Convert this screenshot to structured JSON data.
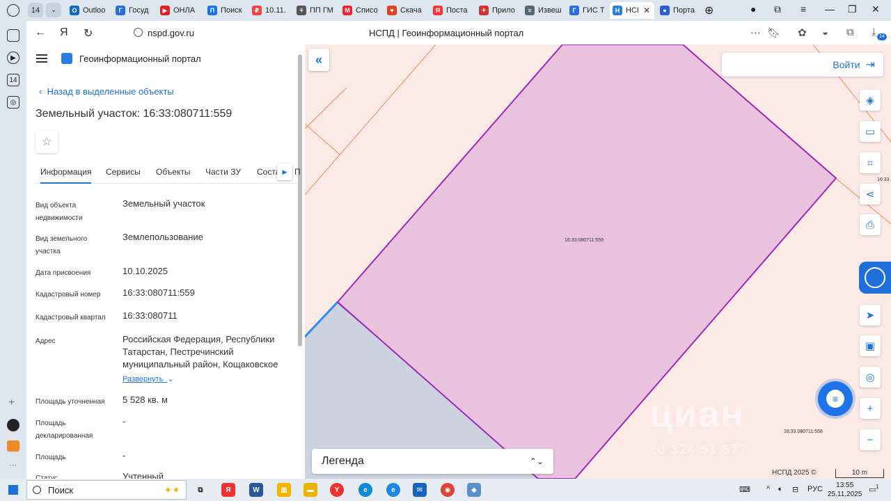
{
  "browser": {
    "tab_count": "14",
    "tabs": [
      {
        "label": "Outloo",
        "color": "#0f6cbd",
        "glyph": "O"
      },
      {
        "label": "Госуд",
        "color": "#2a6fd6",
        "glyph": "Г"
      },
      {
        "label": "ОНЛА",
        "color": "#d22",
        "glyph": "▶"
      },
      {
        "label": "Поиск",
        "color": "#1a73e8",
        "glyph": "П"
      },
      {
        "label": "10.11.",
        "color": "#e44",
        "glyph": "₽"
      },
      {
        "label": "ПП ГМ",
        "color": "#555",
        "glyph": "⚘"
      },
      {
        "label": "Списо",
        "color": "#e23",
        "glyph": "M"
      },
      {
        "label": "Скача",
        "color": "#d42",
        "glyph": "♥"
      },
      {
        "label": "Поста",
        "color": "#f33",
        "glyph": "Я"
      },
      {
        "label": "Прило",
        "color": "#c33",
        "glyph": "✈"
      },
      {
        "label": "Извеш",
        "color": "#567",
        "glyph": "≡"
      },
      {
        "label": "ГИС Т",
        "color": "#2a6fd6",
        "glyph": "Г"
      },
      {
        "label": "НСІ",
        "color": "#2a7de1",
        "glyph": "Н",
        "active": true
      },
      {
        "label": "Порта",
        "color": "#2a5cd6",
        "glyph": "●"
      }
    ],
    "url": "nspd.gov.ru",
    "page_title": "НСПД | Геоинформационный портал",
    "extension_badge": "14"
  },
  "panel": {
    "portal_name": "Геоинформационный портал",
    "back_link": "Назад в выделенные объекты",
    "title": "Земельный участок: 16:33:080711:559",
    "tabs": [
      "Информация",
      "Сервисы",
      "Объекты",
      "Части ЗУ",
      "Соста",
      "П"
    ],
    "expand_link": "Развернуть",
    "rows": [
      {
        "label": "Вид объекта недвижимости",
        "value": "Земельный участок"
      },
      {
        "label": "Вид земельного участка",
        "value": "Землепользование"
      },
      {
        "label": "Дата присвоения",
        "value": "10.10.2025"
      },
      {
        "label": "Кадастровый номер",
        "value": "16:33:080711:559"
      },
      {
        "label": "Кадастровый квартал",
        "value": "16:33:080711"
      },
      {
        "label": "Адрес",
        "value": "Российская Федерация, Республики Татарстан, Пестречинский муниципальный район, Кощаковское"
      },
      {
        "label": "Площадь уточненная",
        "value": "5 528 кв. м"
      },
      {
        "label": "Площадь декларированная",
        "value": "-"
      },
      {
        "label": "Площадь",
        "value": "-"
      },
      {
        "label": "Статус",
        "value": "Учтенный"
      }
    ]
  },
  "map": {
    "login_label": "Войти",
    "plot_label": "16:33:080711:559",
    "side_label_right": "16:33",
    "side_label_bottom": "16:33.080711:558",
    "legend_label": "Легенда",
    "copyright": "НСПД 2025 ©",
    "scale_label": "10 m",
    "watermark": "циан",
    "watermark_phone": "10 324 51 572",
    "colors": {
      "plot_fill": "#e9c2dd",
      "plot_stroke": "#9b2bb5",
      "neighbor_fill": "#cdd2df",
      "neighbor_stroke": "#5544cc",
      "bg": "#fbe9e5",
      "grid": "#f08a5d"
    }
  },
  "taskbar": {
    "search_placeholder": "Поиск",
    "lang": "РУС",
    "time": "13:55",
    "date": "25.11.2025",
    "notif_count": "1"
  }
}
